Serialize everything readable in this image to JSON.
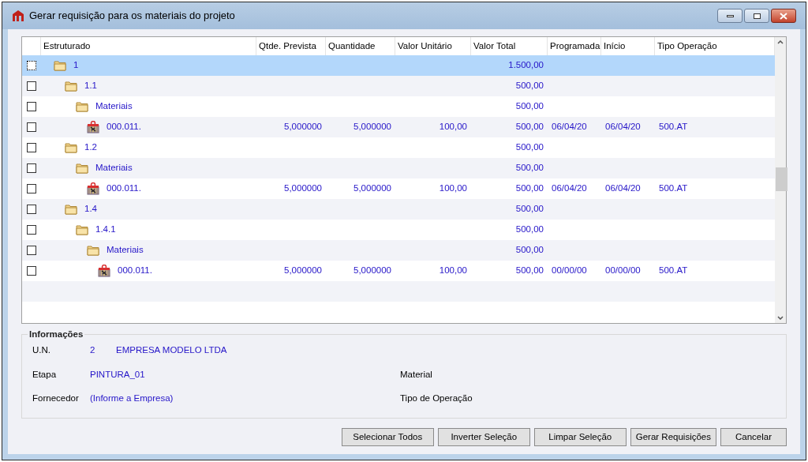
{
  "window": {
    "title": "Gerar requisição para os materiais do projeto"
  },
  "table": {
    "columns": [
      "Estruturado",
      "Qtde. Prevista",
      "Quantidade",
      "Valor Unitário",
      "Valor Total",
      "Programada",
      "Início",
      "Tipo Operação"
    ],
    "rows": [
      {
        "kind": "folder",
        "label": "1",
        "selected": true,
        "checked": false,
        "valor_total": "1.500,00",
        "children": [
          {
            "kind": "folder",
            "label": "1.1",
            "selected": false,
            "checked": false,
            "valor_total": "500,00",
            "children": [
              {
                "kind": "folder",
                "label": "Materiais",
                "selected": false,
                "checked": false,
                "valor_total": "500,00",
                "children": [
                  {
                    "kind": "material",
                    "label": "000.011.",
                    "selected": false,
                    "checked": false,
                    "qtde_prevista": "5,000000",
                    "quantidade": "5,000000",
                    "valor_unitario": "100,00",
                    "valor_total": "500,00",
                    "programada": "06/04/20",
                    "inicio": "06/04/20",
                    "tipo_operacao": "500.AT"
                  }
                ]
              }
            ]
          },
          {
            "kind": "folder",
            "label": "1.2",
            "selected": false,
            "checked": false,
            "valor_total": "500,00",
            "children": [
              {
                "kind": "folder",
                "label": "Materiais",
                "selected": false,
                "checked": false,
                "valor_total": "500,00",
                "children": [
                  {
                    "kind": "material",
                    "label": "000.011.",
                    "selected": false,
                    "checked": false,
                    "qtde_prevista": "5,000000",
                    "quantidade": "5,000000",
                    "valor_unitario": "100,00",
                    "valor_total": "500,00",
                    "programada": "06/04/20",
                    "inicio": "06/04/20",
                    "tipo_operacao": "500.AT"
                  }
                ]
              }
            ]
          },
          {
            "kind": "folder",
            "label": "1.4",
            "selected": false,
            "checked": false,
            "valor_total": "500,00",
            "children": [
              {
                "kind": "folder",
                "label": "1.4.1",
                "selected": false,
                "checked": false,
                "valor_total": "500,00",
                "children": [
                  {
                    "kind": "folder",
                    "label": "Materiais",
                    "selected": false,
                    "checked": false,
                    "valor_total": "500,00",
                    "children": [
                      {
                        "kind": "material",
                        "label": "000.011.",
                        "selected": false,
                        "checked": false,
                        "qtde_prevista": "5,000000",
                        "quantidade": "5,000000",
                        "valor_unitario": "100,00",
                        "valor_total": "500,00",
                        "programada": "00/00/00",
                        "inicio": "00/00/00",
                        "tipo_operacao": "500.AT"
                      }
                    ]
                  }
                ]
              }
            ]
          }
        ]
      }
    ]
  },
  "info": {
    "title": "Informações",
    "un": {
      "label": "U.N.",
      "code": "2",
      "name": "EMPRESA MODELO LTDA"
    },
    "etapa": {
      "label": "Etapa",
      "value": "PINTURA_01"
    },
    "fornecedor": {
      "label": "Fornecedor",
      "value": "(Informe a Empresa)"
    },
    "material": {
      "label": "Material"
    },
    "tipo_operacao": {
      "label": "Tipo de Operação"
    }
  },
  "buttons": [
    "Selecionar Todos",
    "Inverter Seleção",
    "Limpar Seleção",
    "Gerar Requisições",
    "Cancelar"
  ]
}
